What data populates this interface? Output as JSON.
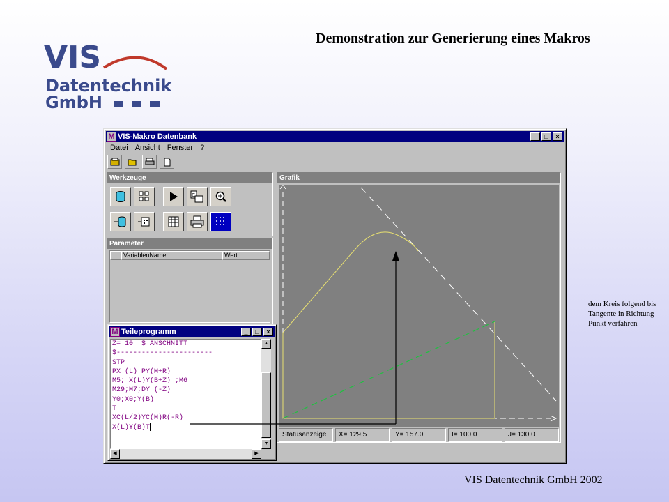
{
  "slide": {
    "title": "Demonstration zur Generierung eines Makros",
    "footer": "VIS Datentechnik GmbH 2002"
  },
  "logo": {
    "line1": "VIS",
    "line2": "Datentechnik",
    "line3": "GmbH",
    "colors": {
      "primary": "#3a4a8c",
      "accent": "#c0392b"
    }
  },
  "app_window": {
    "title": "VIS-Makro Datenbank",
    "icon_letter": "M",
    "menu": [
      "Datei",
      "Ansicht",
      "Fenster",
      "?"
    ],
    "toolbar_icons": [
      "open-db-icon",
      "open-folder-icon",
      "print-icon",
      "new-document-icon"
    ],
    "window_buttons": [
      "_",
      "□",
      "×"
    ]
  },
  "werkzeuge": {
    "header": "Werkzeuge",
    "row1_icons": [
      "database-icon",
      "grid-layout-icon",
      "run-icon",
      "compile-icon",
      "zoom-icon"
    ],
    "row2_icons": [
      "import-db-icon",
      "export-icon",
      "table-icon",
      "printer-icon",
      "dotted-grid-icon"
    ]
  },
  "parameter": {
    "header": "Parameter",
    "columns": [
      "",
      "VariablenName",
      "Wert"
    ]
  },
  "grafik": {
    "header": "Grafik",
    "annotation": [
      "dem Kreis  folgend bis",
      "Tangente in Richtung",
      "Punkt verfahren"
    ],
    "status": [
      "Statusanzeige",
      "X= 129.5",
      "Y= 157.0",
      "I= 100.0",
      "J= 130.0"
    ]
  },
  "teileprogramm": {
    "title": "Teileprogramm",
    "icon_letter": "M",
    "lines": [
      "Z= 10  $ ANSCHNITT",
      "$-----------------------",
      "STP",
      "PX (L) PY(M+R)",
      "M5; X(L)Y(B+Z) ;M6",
      "M29;M7;DY (-Z)",
      "Y0;X0;Y(B)",
      "T",
      "XC(L/2)YC(M)R(-R)",
      "X(L)Y(B)T"
    ]
  },
  "colors": {
    "titlebar": "#000080",
    "window_face": "#c0c0c0",
    "canvas": "#808080",
    "path_yellow": "#e8e070",
    "path_green": "#20c040",
    "guide_white": "#ffffff",
    "code_text": "#800080"
  }
}
